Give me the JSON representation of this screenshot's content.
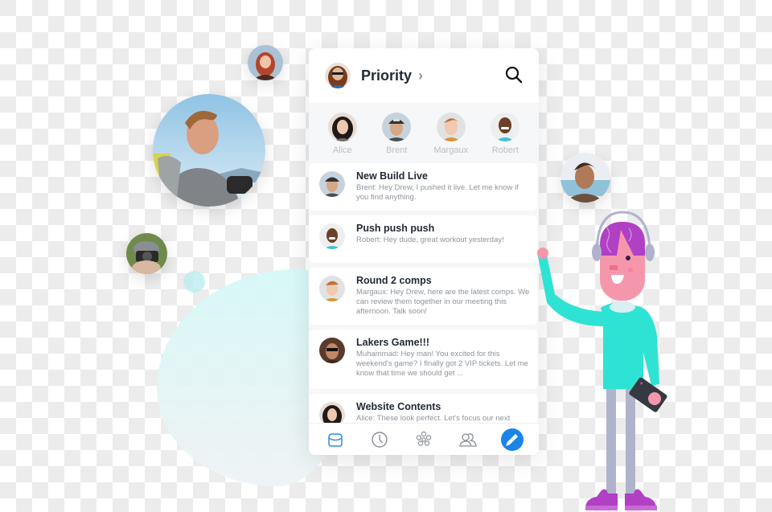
{
  "header": {
    "title": "Priority",
    "chevron": "›",
    "search_icon": "search-icon",
    "user_avatar": "avatar-drew"
  },
  "favorites": [
    {
      "name": "Alice"
    },
    {
      "name": "Brent"
    },
    {
      "name": "Margaux"
    },
    {
      "name": "Robert"
    }
  ],
  "messages": [
    {
      "subject": "New Build Live",
      "preview": "Brent: Hey Drew, I pushed it live. Let me know if you find anything.",
      "sender": "Brent"
    },
    {
      "subject": "Push push push",
      "preview": "Robert: Hey dude, great workout yesterday!",
      "sender": "Robert"
    },
    {
      "subject": "Round 2 comps",
      "preview": "Margaux: Hey Drew, here are the latest comps. We can review them together in our meeting this afternoon. Talk soon!",
      "sender": "Margaux"
    },
    {
      "subject": "Lakers Game!!!",
      "preview": "Muhammad: Hey man! You excited for this weekend's game? I finally got 2 VIP tickets. Let me know that time we should get ...",
      "sender": "Muhammad"
    },
    {
      "subject": "Website Contents",
      "preview": "Alice: These look perfect. Let's focus our next",
      "sender": "Alice"
    }
  ],
  "tabbar": {
    "items": [
      "inbox-icon",
      "clock-icon",
      "groups-icon",
      "contacts-icon"
    ],
    "compose": "pencil-icon",
    "active_color": "#1a84ea"
  },
  "colors": {
    "accent": "#1a84ea",
    "character_shirt": "#2ee3d4",
    "character_hair": "#b040c4",
    "character_skin": "#f497ad"
  }
}
